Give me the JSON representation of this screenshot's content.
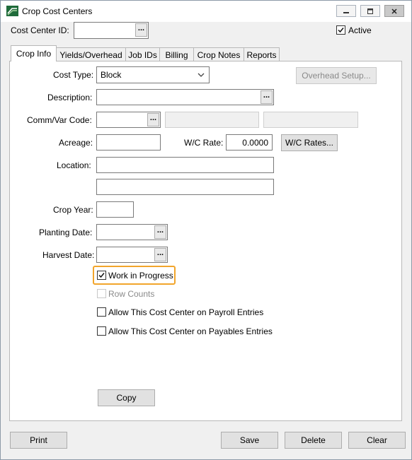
{
  "window": {
    "title": "Crop Cost Centers",
    "colors": {
      "highlight": "#f2a52b",
      "tab_panel": "#ffffff",
      "window_bg": "#f0f0f0"
    }
  },
  "header": {
    "cost_center_label": "Cost Center  ID:",
    "id_value": "",
    "ellipsis": "...",
    "active_label": "Active",
    "active_checked": true
  },
  "tabs": [
    {
      "label": "Crop Info",
      "active": true
    },
    {
      "label": "Yields/Overhead"
    },
    {
      "label": "Job IDs"
    },
    {
      "label": "Billing"
    },
    {
      "label": "Crop Notes"
    },
    {
      "label": "Reports"
    }
  ],
  "form": {
    "cost_type_label": "Cost Type:",
    "cost_type_value": "Block",
    "overhead_setup_button": "Overhead Setup...",
    "description_label": "Description:",
    "description_value": "",
    "comm_var_label": "Comm/Var Code:",
    "comm_var_value": "",
    "acreage_label": "Acreage:",
    "acreage_value": "",
    "wc_rate_label": "W/C Rate:",
    "wc_rate_value": "0.0000",
    "wc_rates_button": "W/C Rates...",
    "location_label": "Location:",
    "location_line1": "",
    "location_line2": "",
    "crop_year_label": "Crop Year:",
    "crop_year_value": "",
    "planting_date_label": "Planting Date:",
    "planting_date_value": "",
    "harvest_date_label": "Harvest Date:",
    "harvest_date_value": "",
    "ellipsis": "...",
    "checkboxes": {
      "work_in_progress": {
        "label": "Work in Progress",
        "checked": true
      },
      "row_counts": {
        "label": "Row Counts",
        "checked": false,
        "disabled": true
      },
      "allow_payroll": {
        "label": "Allow This Cost Center on Payroll Entries",
        "checked": false
      },
      "allow_payables": {
        "label": "Allow This Cost Center on Payables Entries",
        "checked": false
      }
    },
    "copy_button": "Copy"
  },
  "footer": {
    "print_button": "Print",
    "save_button": "Save",
    "delete_button": "Delete",
    "clear_button": "Clear"
  }
}
